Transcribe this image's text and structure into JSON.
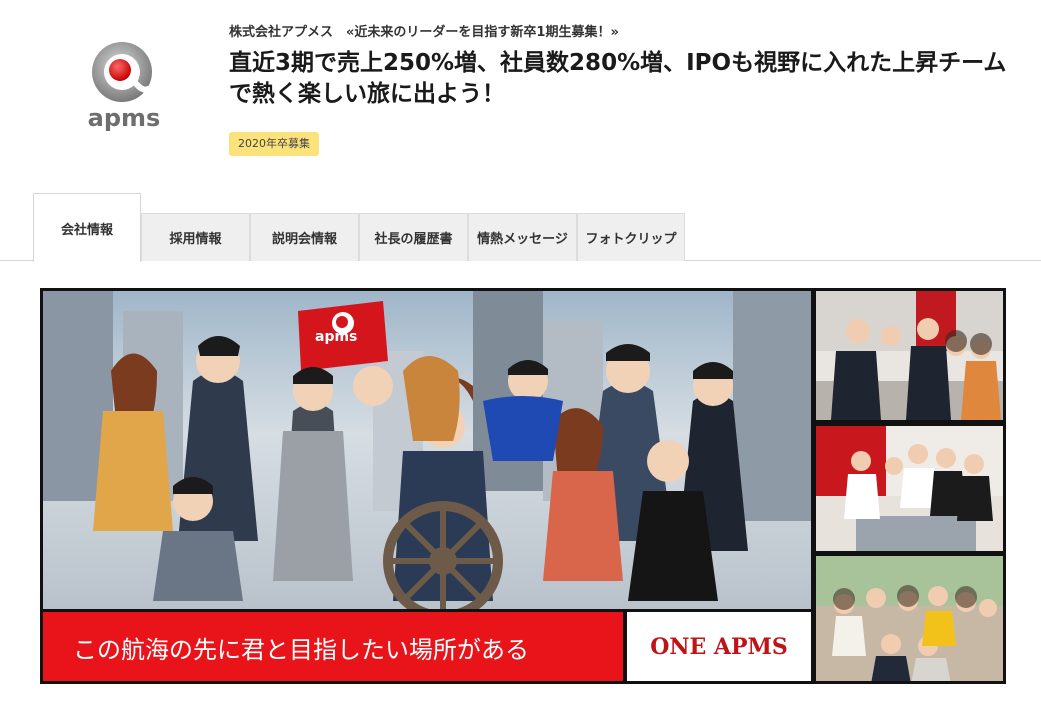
{
  "company": {
    "logo_text": "apms",
    "line": "株式会社アプメス　«近未来のリーダーを目指す新卒1期生募集！»"
  },
  "headline": "直近3期で売上250%増、社員数280%増、IPOも視野に入れた上昇チームで熱く楽しい旅に出よう！",
  "badge": "2020年卒募集",
  "tabs": [
    {
      "label": "会社情報",
      "active": true
    },
    {
      "label": "採用情報",
      "active": false
    },
    {
      "label": "説明会情報",
      "active": false
    },
    {
      "label": "社長の履歴書",
      "active": false
    },
    {
      "label": "情熱メッセージ",
      "active": false
    },
    {
      "label": "フォトクリップ",
      "active": false
    }
  ],
  "banner": {
    "flag_logo": "apms",
    "caption": "この航海の先に君と目指したい場所がある",
    "slogan": "ONE APMS"
  },
  "colors": {
    "accent_red": "#e8141a",
    "badge_yellow": "#fbe27a",
    "tab_bg": "#efefef"
  }
}
